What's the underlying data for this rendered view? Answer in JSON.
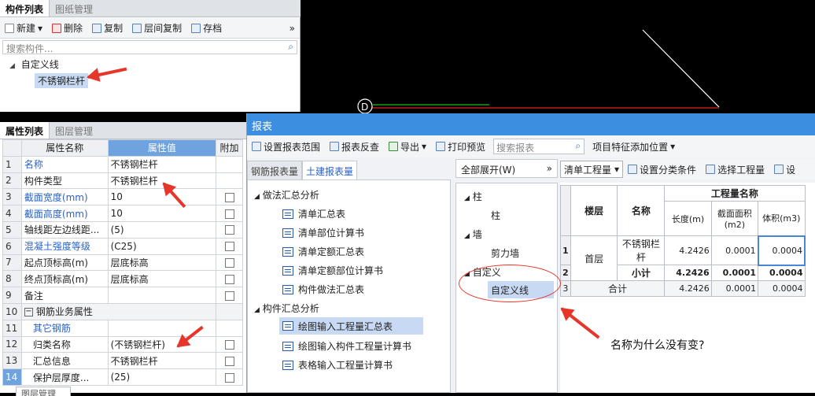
{
  "component_panel": {
    "tabs": [
      "构件列表",
      "图纸管理"
    ],
    "toolbar": {
      "new": "新建",
      "delete": "删除",
      "copy": "复制",
      "floor_copy": "层间复制",
      "archive": "存档",
      "more": "»"
    },
    "search_placeholder": "搜索构件...",
    "tree": {
      "group": "自定义线",
      "item": "不锈钢栏杆"
    }
  },
  "property_panel": {
    "tabs": [
      "属性列表",
      "图层管理"
    ],
    "headers": {
      "name": "属性名称",
      "value": "属性值",
      "add": "附加"
    },
    "rows": [
      {
        "num": "1",
        "name": "名称",
        "value": "不锈钢栏杆"
      },
      {
        "num": "2",
        "name": "构件类型",
        "value": "不锈钢栏杆"
      },
      {
        "num": "3",
        "name": "截面宽度(mm)",
        "value": "10"
      },
      {
        "num": "4",
        "name": "截面高度(mm)",
        "value": "10"
      },
      {
        "num": "5",
        "name": "轴线距左边线距...",
        "value": "(5)"
      },
      {
        "num": "6",
        "name": "混凝土强度等级",
        "value": "(C25)"
      },
      {
        "num": "7",
        "name": "起点顶标高(m)",
        "value": "层底标高"
      },
      {
        "num": "8",
        "name": "终点顶标高(m)",
        "value": "层底标高"
      },
      {
        "num": "9",
        "name": "备注",
        "value": ""
      },
      {
        "num": "10",
        "name": "钢筋业务属性",
        "value": ""
      },
      {
        "num": "11",
        "name": "其它钢筋",
        "value": ""
      },
      {
        "num": "12",
        "name": "归类名称",
        "value": "(不锈钢栏杆)"
      },
      {
        "num": "13",
        "name": "汇总信息",
        "value": "不锈钢栏杆"
      },
      {
        "num": "14",
        "name": "保护层厚度...",
        "value": "(25)"
      }
    ],
    "collapse_symbol": "−",
    "bottom_tab": "图层管理"
  },
  "canvas": {
    "marker": "D"
  },
  "report": {
    "title": "报表",
    "toolbar": {
      "set_range": "设置报表范围",
      "reverse": "报表反查",
      "export": "导出",
      "print": "打印预览",
      "search_placeholder": "搜索报表",
      "add_position": "项目特征添加位置"
    },
    "tabs": [
      "钢筋报表量",
      "土建报表量"
    ],
    "groups": [
      {
        "title": "做法汇总分析",
        "items": [
          "清单汇总表",
          "清单部位计算书",
          "清单定额汇总表",
          "清单定额部位计算书",
          "构件做法汇总表"
        ]
      },
      {
        "title": "构件汇总分析",
        "items": [
          "绘图输入工程量汇总表",
          "绘图输入构件工程量计算书",
          "表格输入工程量计算书"
        ]
      }
    ],
    "expand_all": "全部展开(W)",
    "category_tree": [
      {
        "group": "柱",
        "child": "柱"
      },
      {
        "group": "墙",
        "child": "剪力墙"
      },
      {
        "group": "自定义",
        "child": "自定义线"
      }
    ],
    "right_toolbar": {
      "select": "清单工程量",
      "set_cond": "设置分类条件",
      "select_qty": "选择工程量",
      "more": "设"
    },
    "table": {
      "header_group": "工程量名称",
      "col_floor": "楼层",
      "col_name": "名称",
      "col_len": "长度(m)",
      "col_area": "截面面积(m2)",
      "col_vol": "体积(m3)",
      "rows": [
        {
          "num": "1",
          "floor": "首层",
          "name": "不锈钢栏杆",
          "len": "4.2426",
          "area": "0.0001",
          "vol": "0.0004"
        },
        {
          "num": "2",
          "floor": "",
          "name": "小计",
          "len": "4.2426",
          "area": "0.0001",
          "vol": "0.0004"
        },
        {
          "num": "3",
          "floor": "合计",
          "name": "",
          "len": "4.2426",
          "area": "0.0001",
          "vol": "0.0004"
        }
      ]
    }
  },
  "annotation": {
    "question": "名称为什么没有变?"
  }
}
